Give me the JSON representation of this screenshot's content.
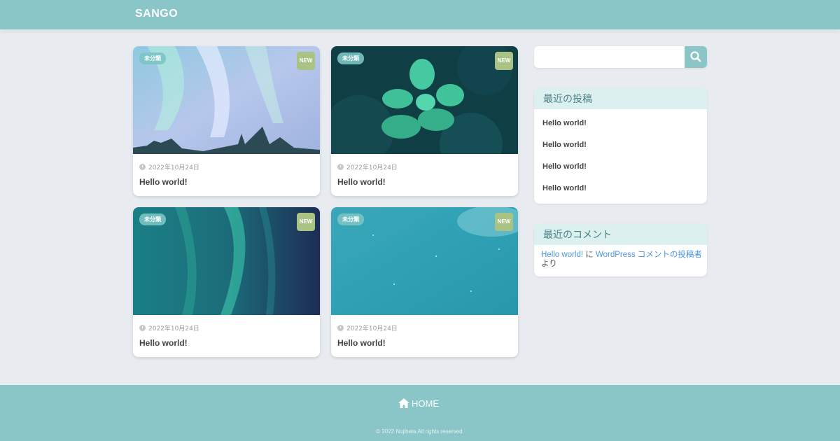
{
  "site": {
    "logo": "SANGO"
  },
  "search": {
    "placeholder": ""
  },
  "posts": [
    {
      "category": "未分類",
      "badge": "NEW",
      "date": "2022年10月24日",
      "title": "Hello world!"
    },
    {
      "category": "未分類",
      "badge": "NEW",
      "date": "2022年10月24日",
      "title": "Hello world!"
    },
    {
      "category": "未分類",
      "badge": "NEW",
      "date": "2022年10月24日",
      "title": "Hello world!"
    },
    {
      "category": "未分類",
      "badge": "NEW",
      "date": "2022年10月24日",
      "title": "Hello world!"
    }
  ],
  "sidebar": {
    "recent_posts_title": "最近の投稿",
    "recent_posts": [
      "Hello world!",
      "Hello world!",
      "Hello world!",
      "Hello world!"
    ],
    "recent_comments_title": "最近のコメント",
    "comment": {
      "post_link": "Hello world!",
      "on": " に ",
      "author": "WordPress コメントの投稿者",
      "by": " より"
    }
  },
  "footer": {
    "home_label": "HOME",
    "copyright": "© 2022 Nojihata All rights reserved."
  },
  "colors": {
    "accent": "#8ac6c8",
    "new_badge": "#a9c385",
    "link": "#4f96e0",
    "widget_head": "#dcf0f0"
  }
}
